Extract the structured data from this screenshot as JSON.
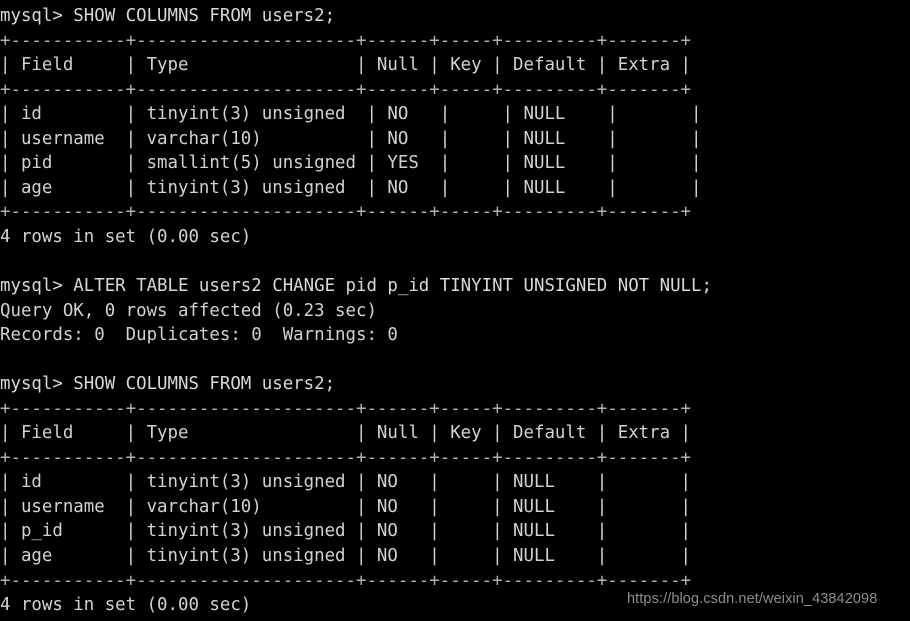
{
  "terminal": {
    "prompt": "mysql> ",
    "background_color": "#000000",
    "text_color": "#d2d2d2",
    "rule_color": "#b9b0a8",
    "lines": [
      "mysql> SHOW COLUMNS FROM users2;",
      "+-----------+---------------------+------+-----+---------+-------+",
      "| Field     | Type                | Null | Key | Default | Extra |",
      "+-----------+---------------------+------+-----+---------+-------+",
      "| id        | tinyint(3) unsigned  | NO   |     | NULL    |       |",
      "| username  | varchar(10)          | NO   |     | NULL    |       |",
      "| pid       | smallint(5) unsigned | YES  |     | NULL    |       |",
      "| age       | tinyint(3) unsigned  | NO   |     | NULL    |       |",
      "+-----------+---------------------+------+-----+---------+-------+",
      "4 rows in set (0.00 sec)",
      "",
      "mysql> ALTER TABLE users2 CHANGE pid p_id TINYINT UNSIGNED NOT NULL;",
      "Query OK, 0 rows affected (0.23 sec)",
      "Records: 0  Duplicates: 0  Warnings: 0",
      "",
      "mysql> SHOW COLUMNS FROM users2;",
      "+-----------+---------------------+------+-----+---------+-------+",
      "| Field     | Type                | Null | Key | Default | Extra |",
      "+-----------+---------------------+------+-----+---------+-------+",
      "| id        | tinyint(3) unsigned | NO   |     | NULL    |       |",
      "| username  | varchar(10)         | NO   |     | NULL    |       |",
      "| p_id      | tinyint(3) unsigned | NO   |     | NULL    |       |",
      "| age       | tinyint(3) unsigned | NO   |     | NULL    |       |",
      "+-----------+---------------------+------+-----+---------+-------+",
      "4 rows in set (0.00 sec)"
    ]
  },
  "queries": {
    "first_show_columns": "SHOW COLUMNS FROM users2;",
    "alter_table": "ALTER TABLE users2 CHANGE pid p_id TINYINT UNSIGNED NOT NULL;",
    "second_show_columns": "SHOW COLUMNS FROM users2;"
  },
  "results": {
    "first_table": {
      "headers": [
        "Field",
        "Type",
        "Null",
        "Key",
        "Default",
        "Extra"
      ],
      "rows": [
        [
          "id",
          "tinyint(3) unsigned",
          "NO",
          "",
          "NULL",
          ""
        ],
        [
          "username",
          "varchar(10)",
          "NO",
          "",
          "NULL",
          ""
        ],
        [
          "pid",
          "smallint(5) unsigned",
          "YES",
          "",
          "NULL",
          ""
        ],
        [
          "age",
          "tinyint(3) unsigned",
          "NO",
          "",
          "NULL",
          ""
        ]
      ],
      "footer": "4 rows in set (0.00 sec)"
    },
    "alter_output": {
      "status": "Query OK, 0 rows affected (0.23 sec)",
      "records": "Records: 0  Duplicates: 0  Warnings: 0"
    },
    "second_table": {
      "headers": [
        "Field",
        "Type",
        "Null",
        "Key",
        "Default",
        "Extra"
      ],
      "rows": [
        [
          "id",
          "tinyint(3) unsigned",
          "NO",
          "",
          "NULL",
          ""
        ],
        [
          "username",
          "varchar(10)",
          "NO",
          "",
          "NULL",
          ""
        ],
        [
          "p_id",
          "tinyint(3) unsigned",
          "NO",
          "",
          "NULL",
          ""
        ],
        [
          "age",
          "tinyint(3) unsigned",
          "NO",
          "",
          "NULL",
          ""
        ]
      ],
      "footer": "4 rows in set (0.00 sec)"
    }
  },
  "watermark": {
    "text": "https://blog.csdn.net/weixin_43842098",
    "color": "#8d8d8d"
  }
}
